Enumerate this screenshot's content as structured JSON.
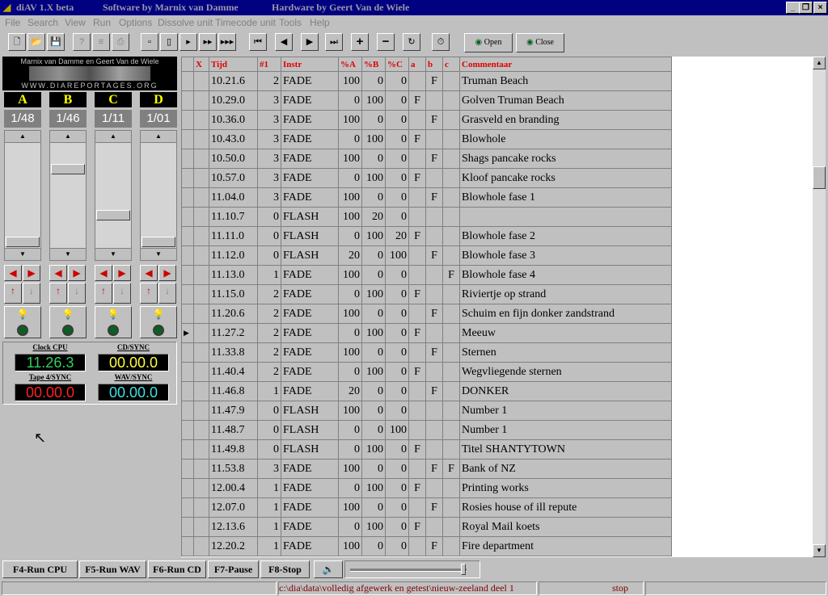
{
  "title": {
    "app": "diAV 1.X beta",
    "software": "Software by Marnix van Damme",
    "hardware": "Hardware by Geert Van de Wiele"
  },
  "menu": [
    "File",
    "Search",
    "View",
    "Run",
    "Options",
    "Dissolve unit",
    "Timecode unit",
    "Tools",
    "Help"
  ],
  "toolbar": {
    "open_label": "Open",
    "close_label": "Close"
  },
  "logo": {
    "line1": "Marnix van Damme en Geert Van de Wiele",
    "line2": "WWW.DIAREPORTAGES.ORG"
  },
  "channels": [
    {
      "name": "A",
      "value": "1/48"
    },
    {
      "name": "B",
      "value": "1/46"
    },
    {
      "name": "C",
      "value": "1/11"
    },
    {
      "name": "D",
      "value": "1/01"
    }
  ],
  "displays": {
    "clock_label": "Clock CPU",
    "clock": "11.26.3",
    "cd_label": "CD/SYNC",
    "cd": "00.00.0",
    "tape_label": "Tape 4/SYNC",
    "tape": "00.00.0",
    "wav_label": "WAV/SYNC",
    "wav": "00.00.0"
  },
  "colors": {
    "clock": "#30d060",
    "cd": "#ffff40",
    "tape": "#ff2020",
    "wav": "#40e0e0"
  },
  "columns": [
    "X",
    "Tijd",
    "#1",
    "Instr",
    "%A",
    "%B",
    "%C",
    "a",
    "b",
    "c",
    "Commentaar"
  ],
  "rows": [
    [
      "",
      "10.21.6",
      "2",
      "FADE",
      "100",
      "0",
      "0",
      "",
      "F",
      "",
      "Truman Beach"
    ],
    [
      "",
      "10.29.0",
      "3",
      "FADE",
      "0",
      "100",
      "0",
      "F",
      "",
      "",
      "Golven Truman Beach"
    ],
    [
      "",
      "10.36.0",
      "3",
      "FADE",
      "100",
      "0",
      "0",
      "",
      "F",
      "",
      "Grasveld en branding"
    ],
    [
      "",
      "10.43.0",
      "3",
      "FADE",
      "0",
      "100",
      "0",
      "F",
      "",
      "",
      "Blowhole"
    ],
    [
      "",
      "10.50.0",
      "3",
      "FADE",
      "100",
      "0",
      "0",
      "",
      "F",
      "",
      "Shags pancake rocks"
    ],
    [
      "",
      "10.57.0",
      "3",
      "FADE",
      "0",
      "100",
      "0",
      "F",
      "",
      "",
      "Kloof pancake rocks"
    ],
    [
      "",
      "11.04.0",
      "3",
      "FADE",
      "100",
      "0",
      "0",
      "",
      "F",
      "",
      "Blowhole fase 1"
    ],
    [
      "",
      "11.10.7",
      "0",
      "FLASH",
      "100",
      "20",
      "0",
      "",
      "",
      "",
      ""
    ],
    [
      "",
      "11.11.0",
      "0",
      "FLASH",
      "0",
      "100",
      "20",
      "F",
      "",
      "",
      "Blowhole fase 2"
    ],
    [
      "",
      "11.12.0",
      "0",
      "FLASH",
      "20",
      "0",
      "100",
      "",
      "F",
      "",
      "Blowhole fase 3"
    ],
    [
      "",
      "11.13.0",
      "1",
      "FADE",
      "100",
      "0",
      "0",
      "",
      "",
      "F",
      "Blowhole fase 4"
    ],
    [
      "",
      "11.15.0",
      "2",
      "FADE",
      "0",
      "100",
      "0",
      "F",
      "",
      "",
      "Riviertje op strand"
    ],
    [
      "",
      "11.20.6",
      "2",
      "FADE",
      "100",
      "0",
      "0",
      "",
      "F",
      "",
      "Schuim en fijn donker zandstrand"
    ],
    [
      "▶",
      "11.27.2",
      "2",
      "FADE",
      "0",
      "100",
      "0",
      "F",
      "",
      "",
      "Meeuw"
    ],
    [
      "",
      "11.33.8",
      "2",
      "FADE",
      "100",
      "0",
      "0",
      "",
      "F",
      "",
      "Sternen"
    ],
    [
      "",
      "11.40.4",
      "2",
      "FADE",
      "0",
      "100",
      "0",
      "F",
      "",
      "",
      "Wegvliegende sternen"
    ],
    [
      "",
      "11.46.8",
      "1",
      "FADE",
      "20",
      "0",
      "0",
      "",
      "F",
      "",
      "DONKER"
    ],
    [
      "",
      "11.47.9",
      "0",
      "FLASH",
      "100",
      "0",
      "0",
      "",
      "",
      "",
      "Number 1"
    ],
    [
      "",
      "11.48.7",
      "0",
      "FLASH",
      "0",
      "0",
      "100",
      "",
      "",
      "",
      "Number 1"
    ],
    [
      "",
      "11.49.8",
      "0",
      "FLASH",
      "0",
      "100",
      "0",
      "F",
      "",
      "",
      "Titel SHANTYTOWN"
    ],
    [
      "",
      "11.53.8",
      "3",
      "FADE",
      "100",
      "0",
      "0",
      "",
      "F",
      "F",
      "Bank of NZ"
    ],
    [
      "",
      "12.00.4",
      "1",
      "FADE",
      "0",
      "100",
      "0",
      "F",
      "",
      "",
      "Printing works"
    ],
    [
      "",
      "12.07.0",
      "1",
      "FADE",
      "100",
      "0",
      "0",
      "",
      "F",
      "",
      "Rosies house of ill repute"
    ],
    [
      "",
      "12.13.6",
      "1",
      "FADE",
      "0",
      "100",
      "0",
      "F",
      "",
      "",
      "Royal Mail koets"
    ],
    [
      "",
      "12.20.2",
      "1",
      "FADE",
      "100",
      "0",
      "0",
      "",
      "F",
      "",
      "Fire department"
    ]
  ],
  "fkeys": [
    "F4-Run CPU",
    "F5-Run WAV",
    "F6-Run CD",
    "F7-Pause",
    "F8-Stop"
  ],
  "status": {
    "path": "c:\\dia\\data\\volledig afgewerk en getest\\nieuw-zeeland deel 1",
    "state": "stop"
  }
}
